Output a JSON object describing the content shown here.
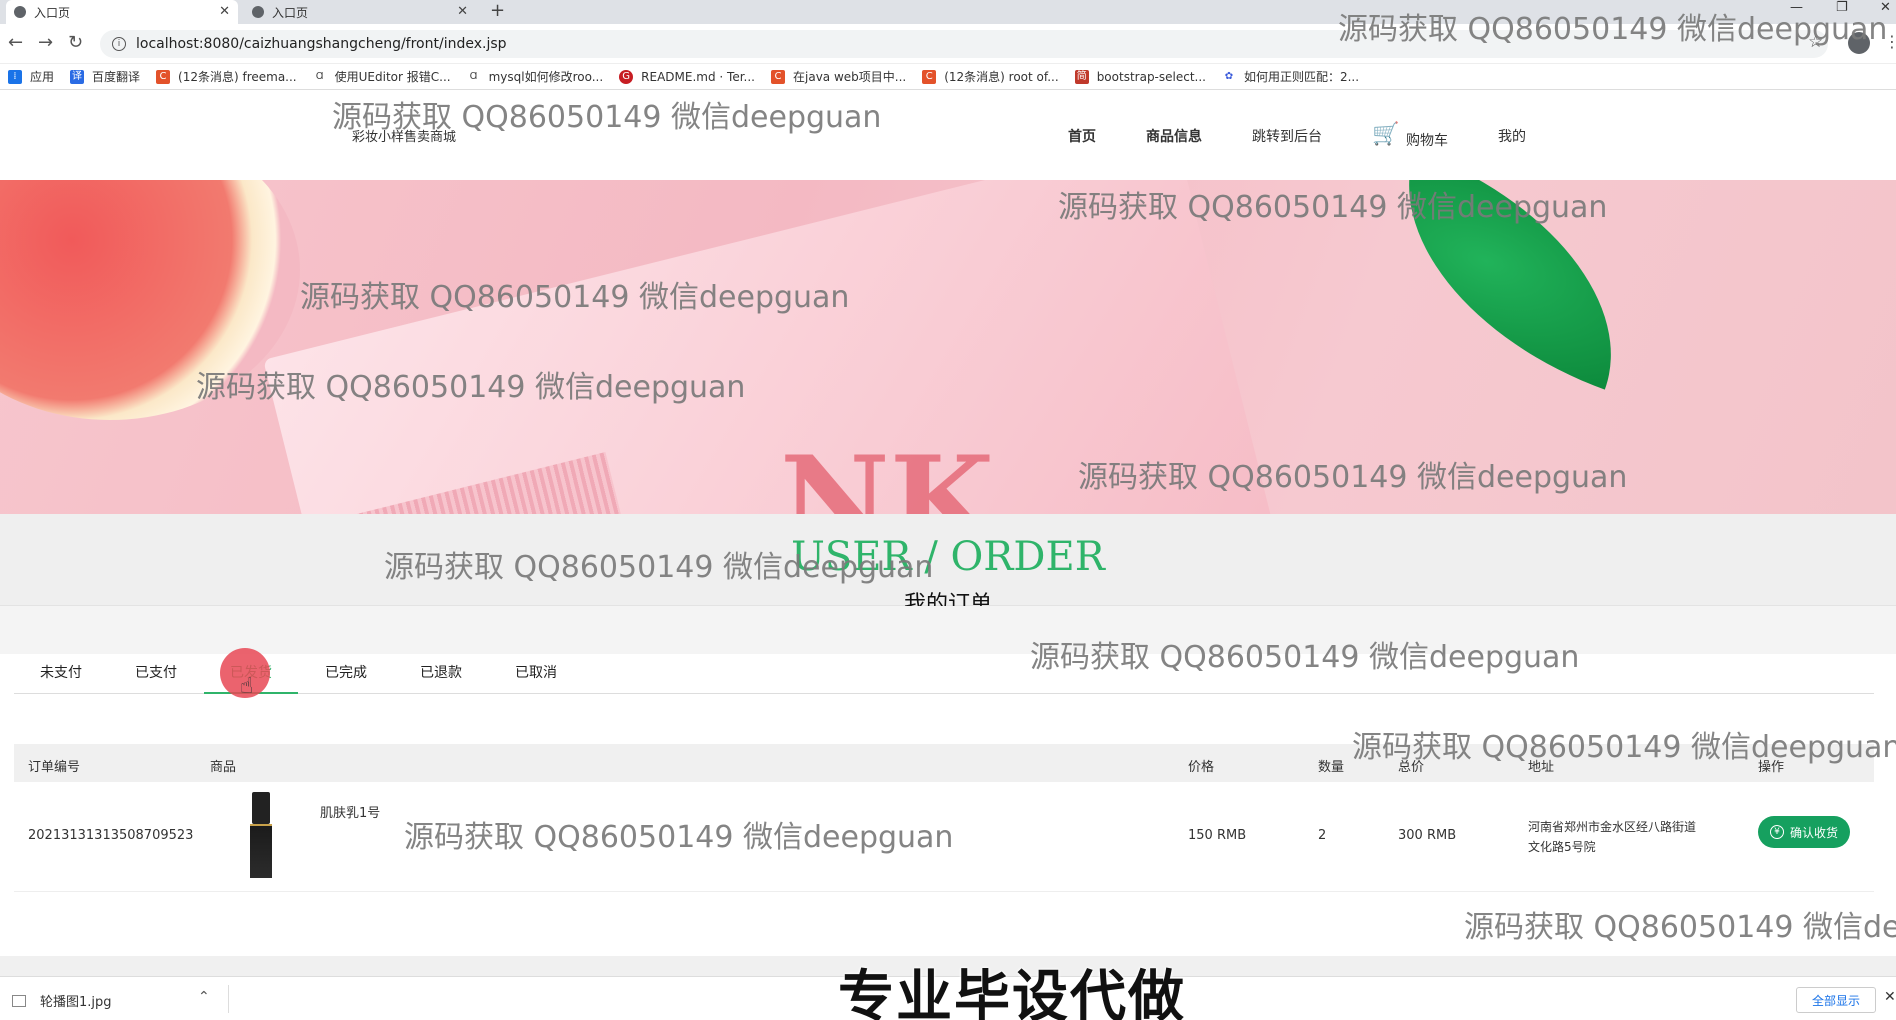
{
  "browser": {
    "tabs": [
      {
        "title": "入口页"
      },
      {
        "title": "入口页"
      }
    ],
    "new_tab": "+",
    "url": "localhost:8080/caizhuangshangcheng/front/index.jsp",
    "bookmarks": [
      {
        "label": "应用",
        "color": "#1a73e8"
      },
      {
        "label": "百度翻译",
        "color": "#2a6be4"
      },
      {
        "label": "(12条消息) freema...",
        "color": "#e3522a"
      },
      {
        "label": "使用UEditor 报错C...",
        "color": "#444444"
      },
      {
        "label": "mysql如何修改roo...",
        "color": "#444444"
      },
      {
        "label": "README.md · Ter...",
        "color": "#c71d23"
      },
      {
        "label": "在java web项目中...",
        "color": "#e3522a"
      },
      {
        "label": "(12条消息) root of...",
        "color": "#e3522a"
      },
      {
        "label": "bootstrap-select...",
        "color": "#c0392b"
      },
      {
        "label": "如何用正则匹配：2...",
        "color": "#3b5bdb"
      }
    ]
  },
  "site": {
    "subtitle": "彩妆小样售卖商城",
    "nav": [
      "首页",
      "商品信息",
      "跳转到后台",
      "购物车",
      "我的"
    ]
  },
  "section": {
    "en": "USER / ORDER",
    "cn": "我的订单"
  },
  "order_tabs": [
    "未支付",
    "已支付",
    "已发货",
    "已完成",
    "已退款",
    "已取消"
  ],
  "active_tab": "已发货",
  "table": {
    "headers": [
      "订单编号",
      "商品",
      "价格",
      "数量",
      "总价",
      "地址",
      "操作"
    ],
    "rows": [
      {
        "order_no": "20213131313508709523",
        "product": "肌肤乳1号",
        "price": "150 RMB",
        "qty": "2",
        "total": "300 RMB",
        "address_l1": "河南省郑州市金水区经八路街道",
        "address_l2": "文化路5号院",
        "action": "确认收货"
      }
    ]
  },
  "downloads": {
    "file": "轮播图1.jpg",
    "show_all": "全部显示"
  },
  "watermark": "源码获取 QQ86050149 微信deepguan",
  "watermark_cut": "源码获取 QQ86050149 微信dee",
  "caption": "专业毕设代做",
  "colors": {
    "accent": "#2fb46a",
    "button": "#16a05f"
  }
}
